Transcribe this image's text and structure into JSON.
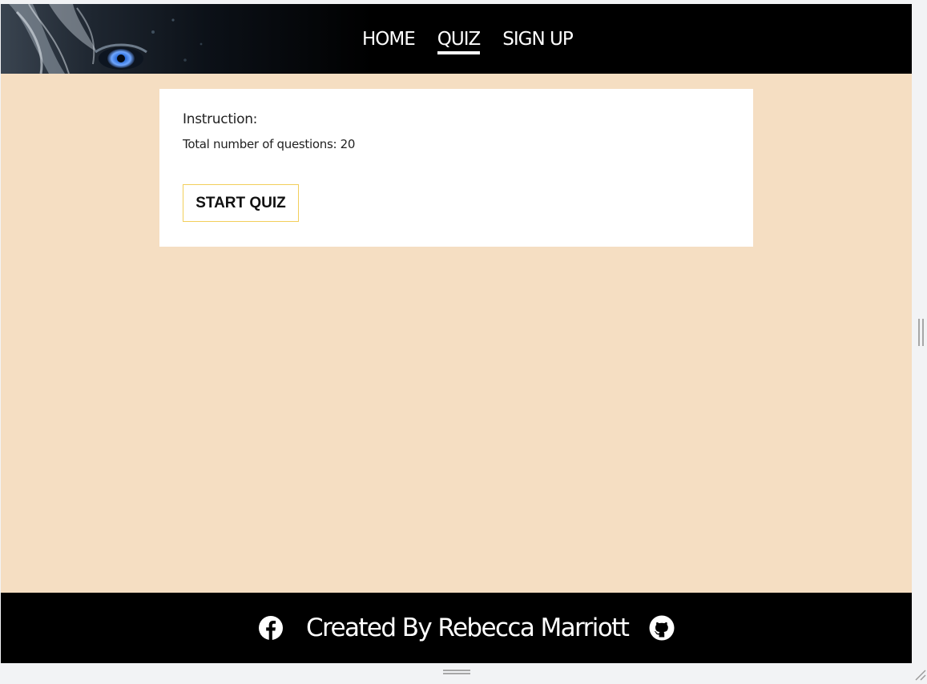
{
  "nav": {
    "items": [
      {
        "label": "HOME",
        "active": false
      },
      {
        "label": "QUIZ",
        "active": true
      },
      {
        "label": "SIGN UP",
        "active": false
      }
    ]
  },
  "quiz_card": {
    "instruction_label": "Instruction:",
    "question_count_text": "Total number of questions: 20",
    "start_button_label": "START QUIZ"
  },
  "footer": {
    "credit_text": "Created By Rebecca Marriott",
    "icons": [
      "facebook-icon",
      "github-icon"
    ]
  },
  "colors": {
    "page_background": "#f5dec2",
    "header_footer": "#000000",
    "card": "#ffffff",
    "button_border": "#f2cf5b",
    "eye_blue": "#3a7be0"
  }
}
